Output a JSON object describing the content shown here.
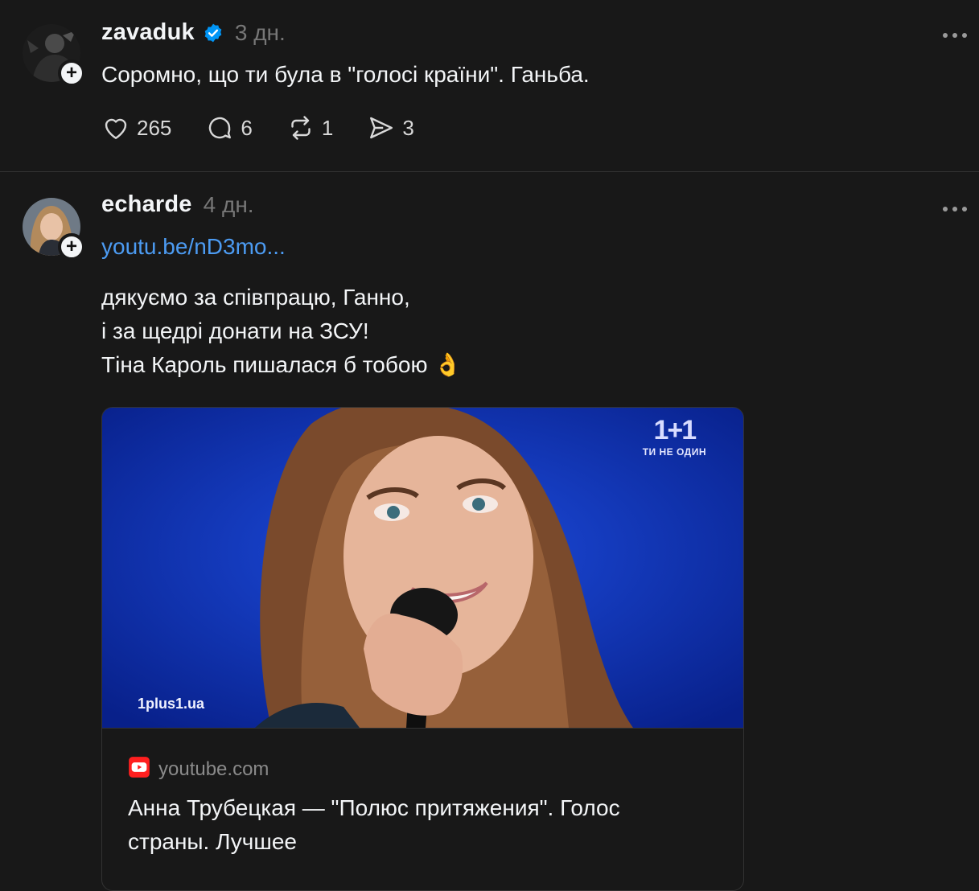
{
  "posts": [
    {
      "username": "zavaduk",
      "verified": true,
      "time": "3 дн.",
      "text": "Соромно, що ти була в \"голосі країни\". Ганьба.",
      "likes": "265",
      "replies": "6",
      "reposts": "1",
      "shares": "3"
    },
    {
      "username": "echarde",
      "verified": false,
      "time": "4 дн.",
      "link": "youtu.be/nD3mo...",
      "text_lines": [
        "дякуємо за співпрацю, Ганно,",
        "і за щедрі донати на ЗСУ!",
        "Тіна Кароль пишалася б тобою 👌"
      ],
      "card": {
        "watermark_logo": "1+1",
        "watermark_tagline": "ТИ НЕ ОДИН",
        "watermark_site": "1plus1.ua",
        "domain": "youtube.com",
        "title": "Анна Трубецкая — \"Полюс притяжения\". Голос страны. Лучшее"
      }
    }
  ],
  "colors": {
    "background": "#181818",
    "text": "#f3f5f7",
    "muted": "#777777",
    "link": "#4c9bf2",
    "verified": "#0095f6",
    "divider": "#333333"
  },
  "icons": [
    "verified-icon",
    "more-icon",
    "heart-icon",
    "reply-icon",
    "repost-icon",
    "share-icon",
    "youtube-icon",
    "plus-icon"
  ]
}
